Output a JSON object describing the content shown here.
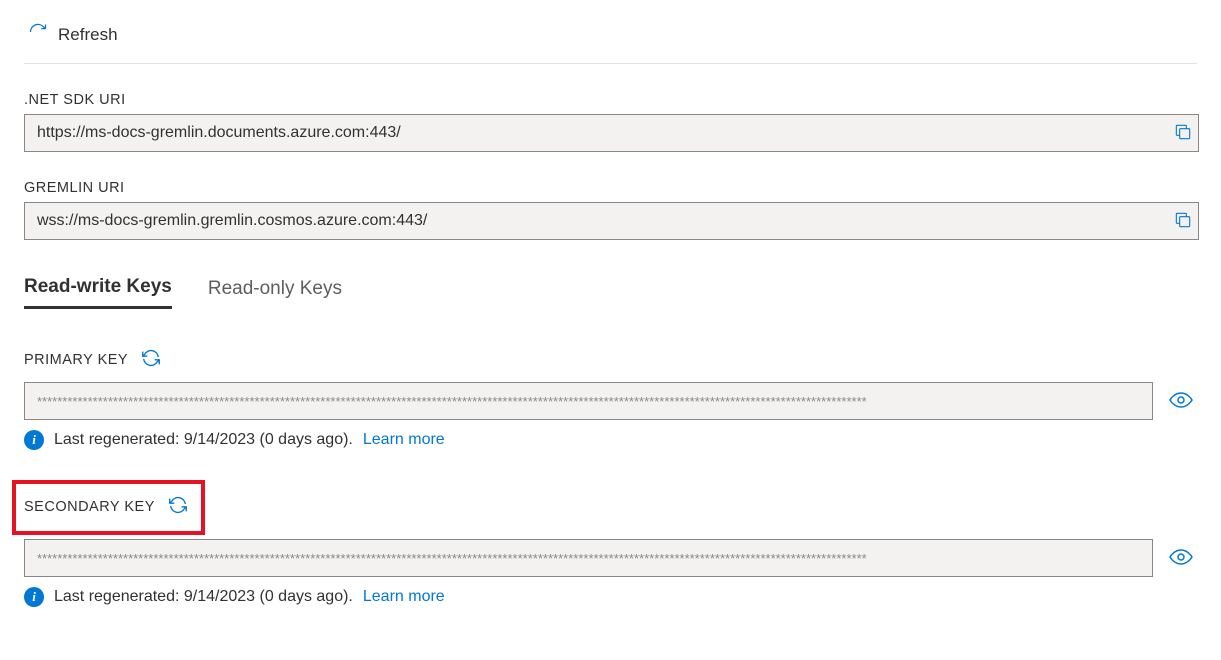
{
  "toolbar": {
    "refresh_label": "Refresh"
  },
  "fields": {
    "net_sdk_label": ".NET SDK URI",
    "net_sdk_value": "https://ms-docs-gremlin.documents.azure.com:443/",
    "gremlin_label": "GREMLIN URI",
    "gremlin_value": "wss://ms-docs-gremlin.gremlin.cosmos.azure.com:443/"
  },
  "tabs": {
    "read_write": "Read-write Keys",
    "read_only": "Read-only Keys"
  },
  "keys": {
    "primary_label": "PRIMARY KEY",
    "primary_value": "********************************************************************************************************************************************************************",
    "primary_info": "Last regenerated: 9/14/2023 (0 days ago).",
    "secondary_label": "SECONDARY KEY",
    "secondary_value": "********************************************************************************************************************************************************************",
    "secondary_info": "Last regenerated: 9/14/2023 (0 days ago).",
    "learn_more": "Learn more"
  }
}
